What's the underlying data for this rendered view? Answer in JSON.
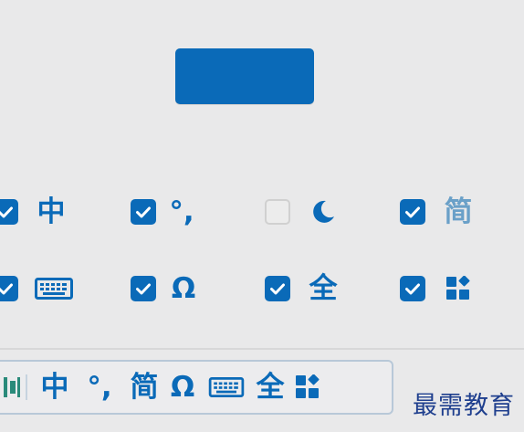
{
  "colors": {
    "accent": "#0a6ab8",
    "background": "#e9e9ea",
    "watermark": "#1f3f8e"
  },
  "primary_button": {
    "label": ""
  },
  "options": [
    {
      "icon": "chinese-mode-icon",
      "text": "中",
      "checked": true
    },
    {
      "icon": "punctuation-icon",
      "text": "°,",
      "checked": true
    },
    {
      "icon": "moon-icon",
      "text": "",
      "checked": false
    },
    {
      "icon": "simplified-chinese-icon",
      "text": "简",
      "checked": true
    },
    {
      "icon": "soft-keyboard-icon",
      "text": "",
      "checked": true
    },
    {
      "icon": "special-symbols-icon",
      "text": "Ω",
      "checked": true
    },
    {
      "icon": "full-width-icon",
      "text": "全",
      "checked": true
    },
    {
      "icon": "toolbox-icon",
      "text": "",
      "checked": true
    }
  ],
  "toolbar": {
    "items": [
      {
        "icon": "drag-handle-icon",
        "text": ""
      },
      {
        "icon": "chinese-mode-icon",
        "text": "中"
      },
      {
        "icon": "punctuation-icon",
        "text": "°,"
      },
      {
        "icon": "simplified-chinese-icon",
        "text": "简"
      },
      {
        "icon": "special-symbols-icon",
        "text": "Ω"
      },
      {
        "icon": "soft-keyboard-icon",
        "text": ""
      },
      {
        "icon": "full-width-icon",
        "text": "全"
      },
      {
        "icon": "toolbox-icon",
        "text": ""
      }
    ]
  },
  "watermark": {
    "text": "最需教育"
  }
}
